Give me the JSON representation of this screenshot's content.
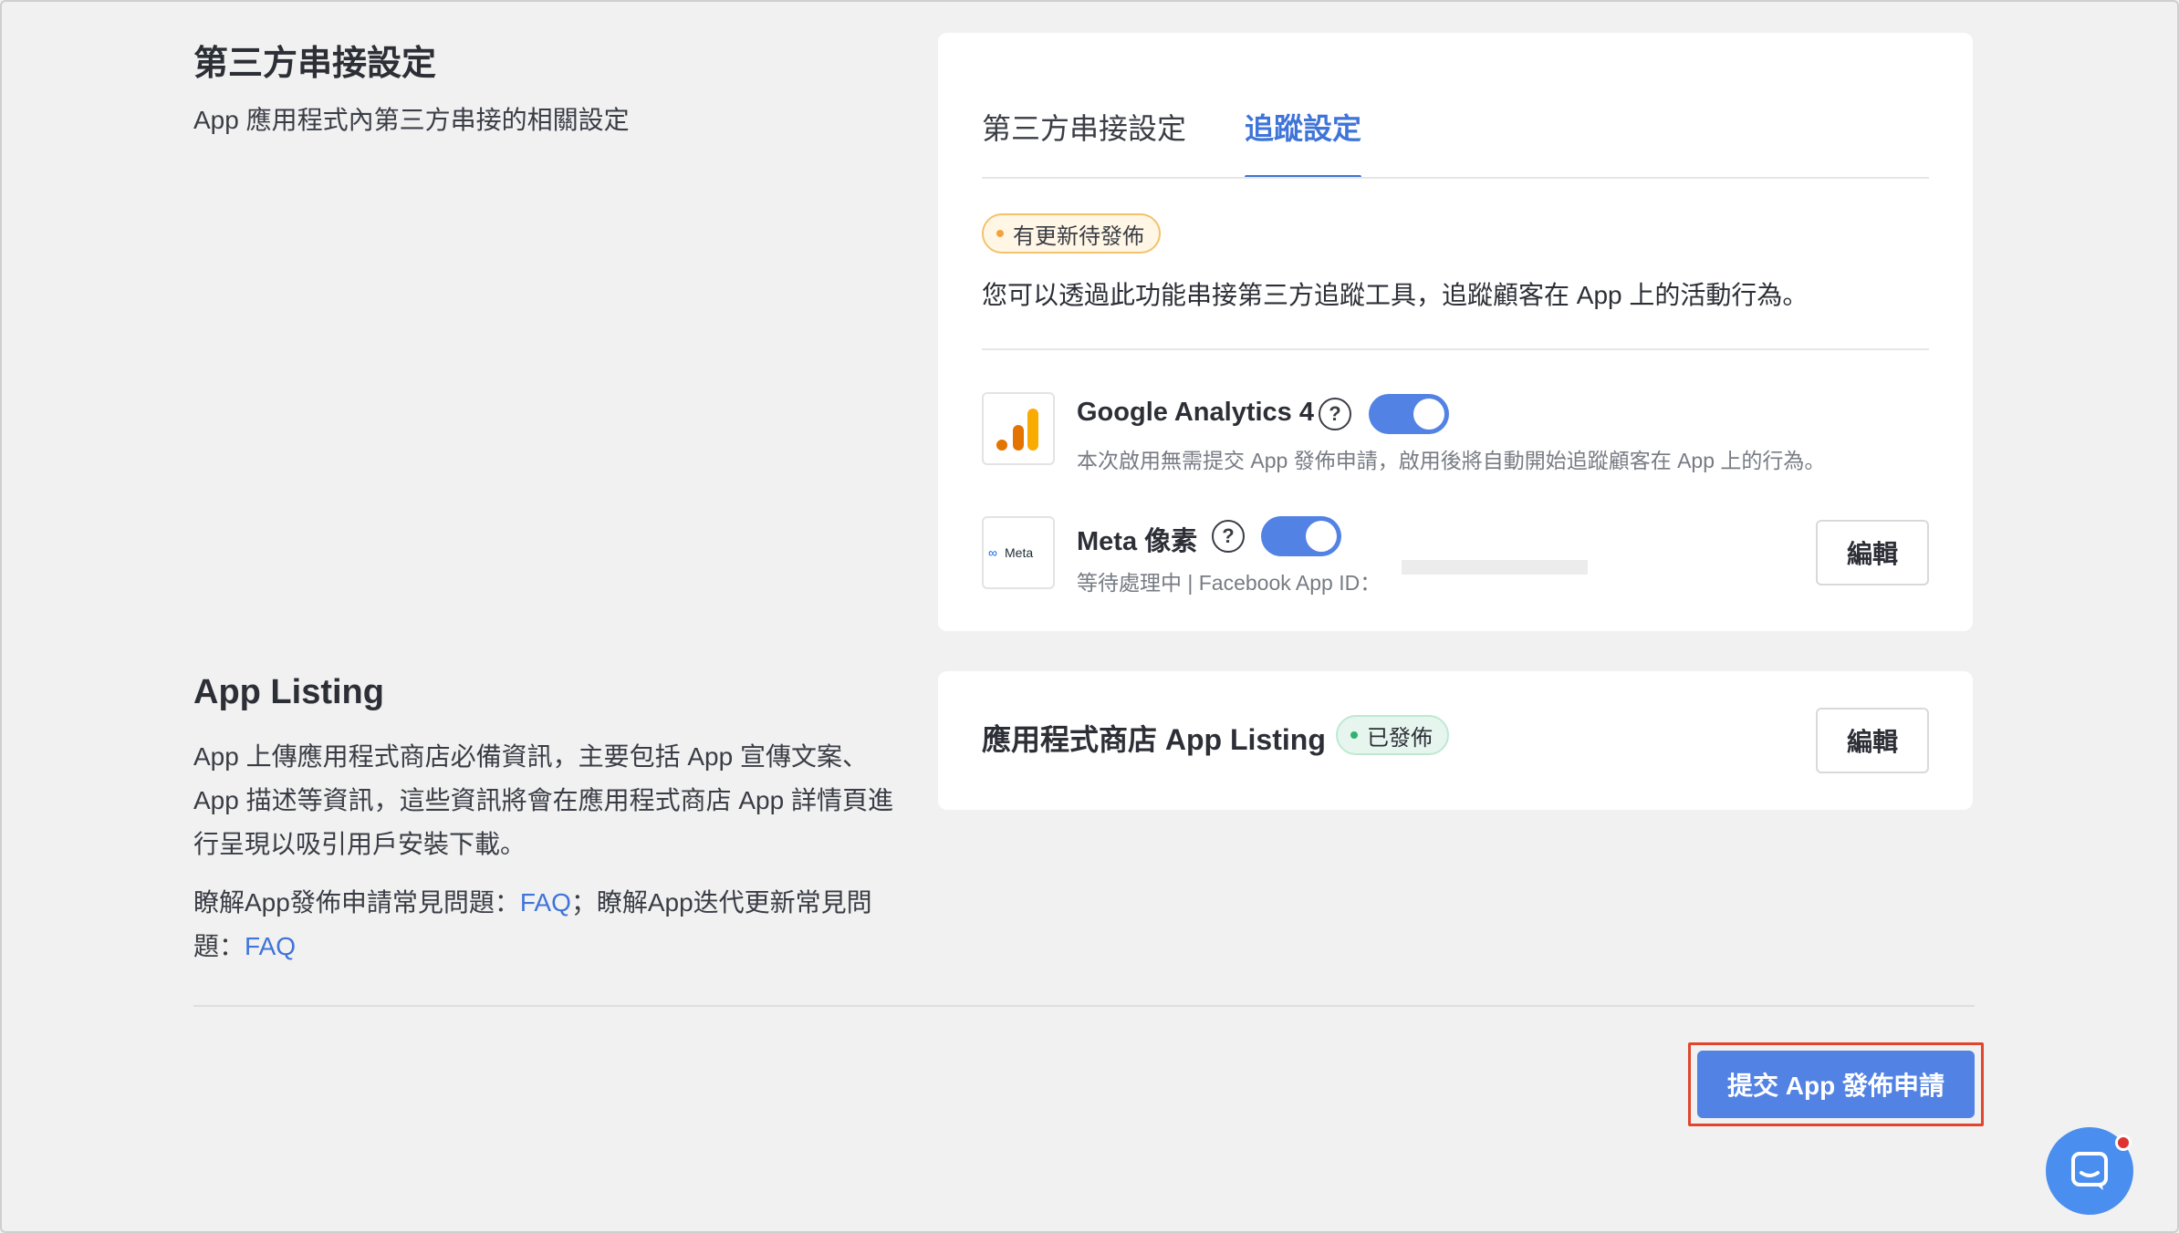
{
  "third_party": {
    "title": "第三方串接設定",
    "description": "App 應用程式內第三方串接的相關設定",
    "tabs": [
      {
        "label": "第三方串接設定",
        "active": false
      },
      {
        "label": "追蹤設定",
        "active": true
      }
    ],
    "pending_badge": "有更新待發佈",
    "intro": "您可以透過此功能串接第三方追蹤工具，追蹤顧客在 App 上的活動行為。",
    "integrations": [
      {
        "name": "Google Analytics 4",
        "subtitle": "本次啟用無需提交 App 發佈申請，啟用後將自動開始追蹤顧客在 App 上的行為。",
        "enabled": true,
        "icon": "google-analytics-icon"
      },
      {
        "name": "Meta 像素",
        "subtitle": "等待處理中 | Facebook App ID：",
        "enabled": true,
        "icon": "meta-logo",
        "logo_text": "Meta",
        "edit_label": "編輯"
      }
    ]
  },
  "app_listing": {
    "title": "App Listing",
    "description": "App 上傳應用程式商店必備資訊，主要包括 App 宣傳文案、App 描述等資訊，這些資訊將會在應用程式商店 App 詳情頁進行呈現以吸引用戶安裝下載。",
    "faq_prefix_1": "瞭解App發佈申請常見問題：",
    "faq_link_1": "FAQ",
    "faq_prefix_2": "；瞭解App迭代更新常見問題：",
    "faq_link_2": "FAQ",
    "card_title": "應用程式商店 App Listing",
    "status_badge": "已發佈",
    "edit_label": "編輯"
  },
  "footer": {
    "submit_label": "提交 App 發佈申請"
  },
  "colors": {
    "accent": "#5282e4",
    "link": "#3f74d9",
    "pending": "#f3a33b",
    "published": "#2fb36f",
    "highlight": "#e0452e"
  },
  "icons": {
    "help": "?",
    "chat": "chat-bubble-icon"
  }
}
